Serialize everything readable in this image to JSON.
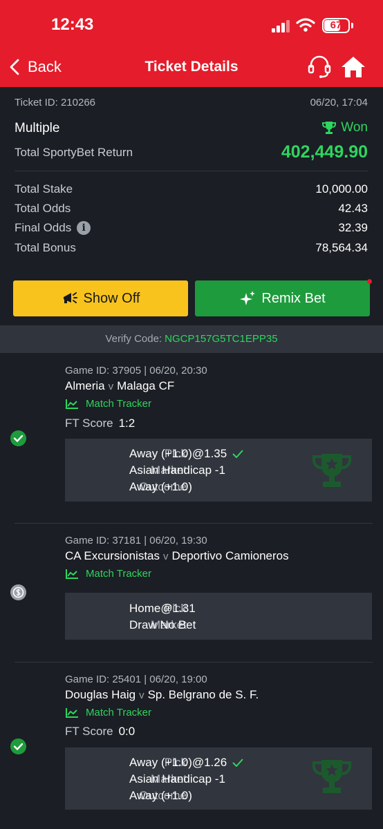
{
  "status_bar": {
    "time": "12:43",
    "battery": "67",
    "battery_fraction": 0.67
  },
  "header": {
    "back_label": "Back",
    "title": "Ticket Details",
    "icons": [
      "headset-icon",
      "home-icon"
    ]
  },
  "summary": {
    "ticket_id": "Ticket ID: 210266",
    "date": "06/20, 17:04",
    "bet_type": "Multiple",
    "result": "Won",
    "return_label": "Total SportyBet Return",
    "return_value": "402,449.90",
    "rows": [
      {
        "label": "Total Stake",
        "value": "10,000.00"
      },
      {
        "label": "Total Odds",
        "value": "42.43"
      },
      {
        "label": "Final Odds",
        "value": "32.39"
      },
      {
        "label": "Total Bonus",
        "value": "78,564.34"
      }
    ]
  },
  "buttons": {
    "show_off": "Show Off",
    "remix": "Remix Bet"
  },
  "verify": {
    "label": "Verify Code:",
    "code": "NGCP157G5TC1EPP35"
  },
  "games": [
    {
      "id_line": "Game ID: 37905 | 06/20, 20:30",
      "home": "Almeria",
      "v": "v",
      "away": "Malaga CF",
      "tracker": "Match Tracker",
      "score_label": "FT Score",
      "score": "1:2",
      "status": "won",
      "pick_label": "Pick",
      "pick": "Away (+1.0)@1.35",
      "market_label": "Market",
      "market": "Asian Handicap -1",
      "outcome_label": "Outcome",
      "outcome": "Away (+1.0)"
    },
    {
      "id_line": "Game ID: 37181 | 06/20, 19:30",
      "home": "CA Excursionistas",
      "v": "v",
      "away": "Deportivo Camioneros",
      "tracker": "Match Tracker",
      "status": "refund",
      "pick_label": "Pick",
      "pick": "Home@1.31",
      "market_label": "Market",
      "market": "Draw No Bet"
    },
    {
      "id_line": "Game ID: 25401 | 06/20, 19:00",
      "home": "Douglas Haig",
      "v": "v",
      "away": "Sp. Belgrano de S. F.",
      "tracker": "Match Tracker",
      "score_label": "FT Score",
      "score": "0:0",
      "status": "won",
      "pick_label": "Pick",
      "pick": "Away (+1.0)@1.26",
      "market_label": "Market",
      "market": "Asian Handicap -1",
      "outcome_label": "Outcome",
      "outcome": "Away (+1.0)"
    }
  ],
  "colors": {
    "brand_red": "#e41c2b",
    "win_green": "#2fd55f",
    "button_yellow": "#f8c31c",
    "button_green": "#1e9b3c"
  }
}
